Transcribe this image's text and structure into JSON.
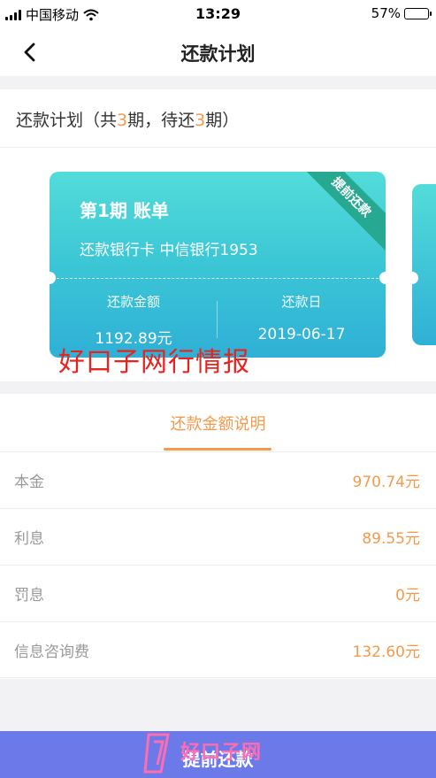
{
  "status_bar": {
    "carrier": "中国移动",
    "time": "13:29",
    "battery": "57%",
    "battery_level": 0.57
  },
  "nav": {
    "title": "还款计划"
  },
  "summary": {
    "prefix": "还款计划（共",
    "total": "3",
    "mid": "期，待还",
    "pending": "3",
    "suffix": "期）"
  },
  "card": {
    "ribbon": "提前还款",
    "period": "第1期 账单",
    "bank": "还款银行卡 中信银行1953",
    "amount_label": "还款金额",
    "amount_value": "1192.89元",
    "date_label": "还款日",
    "date_value": "2019-06-17"
  },
  "watermark": {
    "text": "好口子网行情报"
  },
  "detail": {
    "tab_label": "还款金额说明",
    "rows": [
      {
        "label": "本金",
        "value": "970.74元"
      },
      {
        "label": "利息",
        "value": "89.55元"
      },
      {
        "label": "罚息",
        "value": "0元"
      },
      {
        "label": "信息咨询费",
        "value": "132.60元"
      }
    ]
  },
  "bottom": {
    "button_label": "提前还款",
    "logo_text": "好口子网"
  },
  "colors": {
    "accent": "#f29b4d",
    "button": "#6b7ae8",
    "card": "#3bc6d6"
  }
}
